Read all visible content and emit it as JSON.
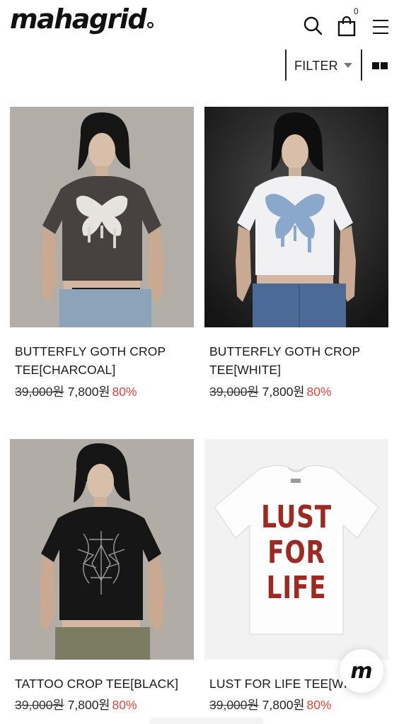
{
  "header": {
    "brand": "mahagrid",
    "cart_count": "0",
    "icons": [
      "search-icon",
      "shopping-bag-icon",
      "hamburger-menu-icon"
    ]
  },
  "toolbar": {
    "filter_label": "FILTER",
    "grid_toggle_icon": "two-column-grid-icon"
  },
  "products": [
    {
      "title": "BUTTERFLY GOTH CROP TEE[CHARCOAL]",
      "title_line1": "BUTTERFLY GOTH CROP",
      "title_line2": "TEE[CHARCOAL]",
      "original_price": "39,000원",
      "sale_price": "7,800원",
      "discount": "80%"
    },
    {
      "title": "BUTTERFLY GOTH CROP TEE[WHITE]",
      "title_line1": "BUTTERFLY GOTH CROP",
      "title_line2": "TEE[WHITE]",
      "original_price": "39,000원",
      "sale_price": "7,800원",
      "discount": "80%"
    },
    {
      "title": "TATTOO CROP TEE[BLACK]",
      "original_price": "39,000원",
      "sale_price": "7,800원",
      "discount": "80%"
    },
    {
      "title": "LUST FOR LIFE TEE[WI",
      "shirt_print": [
        "LUST",
        "FOR",
        "LIFE"
      ],
      "original_price": "39,000원",
      "sale_price": "7,800원",
      "discount": "80%"
    }
  ],
  "chat_button": {
    "label": "m"
  },
  "colors": {
    "discount": "#d9453f",
    "text": "#1a1a1a",
    "print_red": "#9b2a22"
  }
}
